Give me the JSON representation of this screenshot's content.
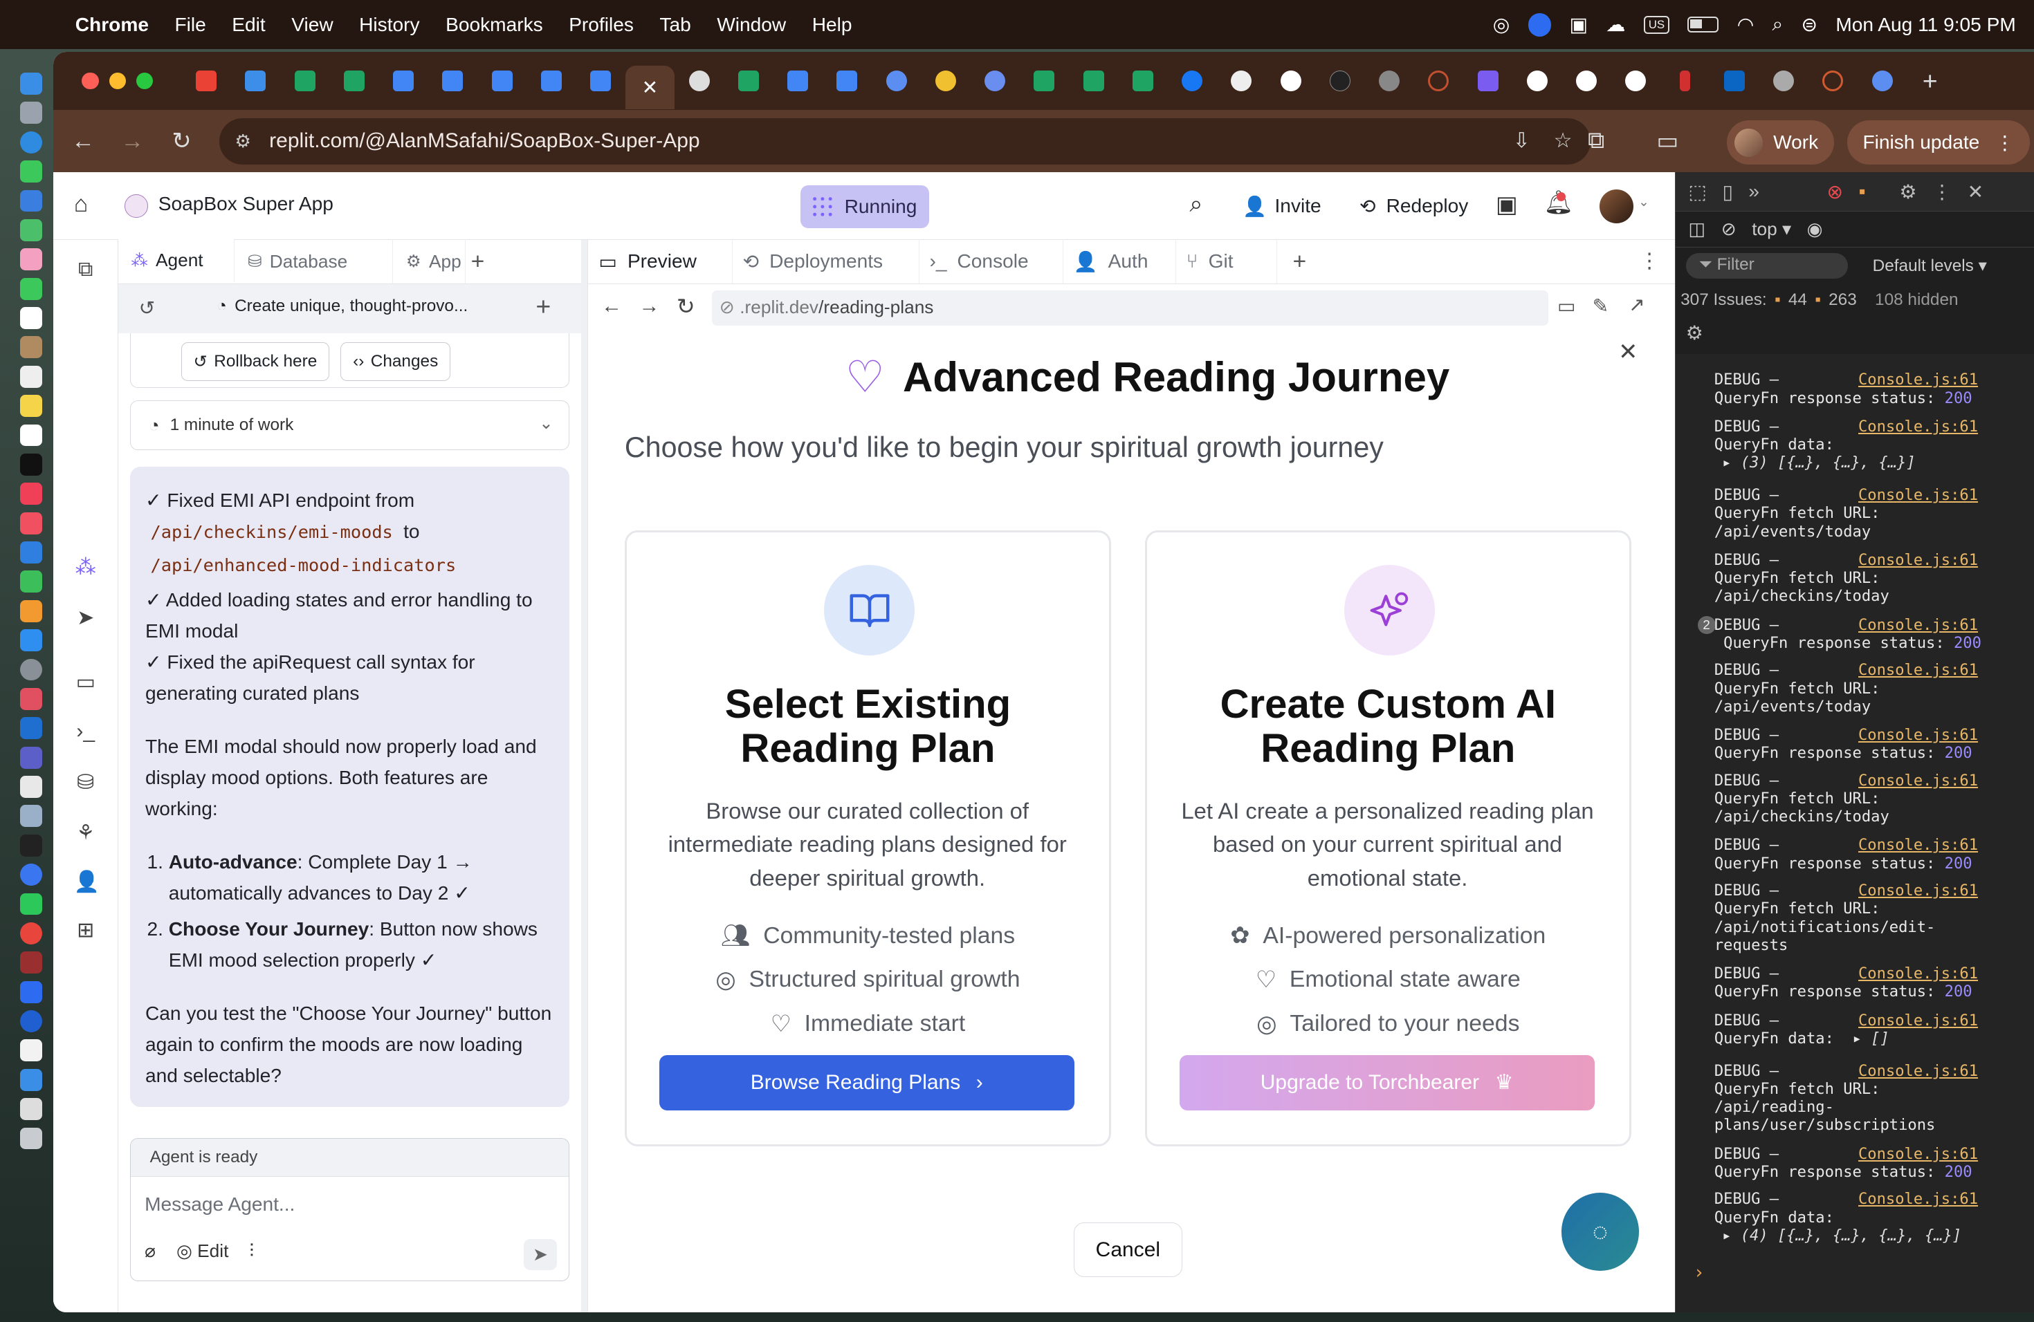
{
  "menubar": {
    "app": "Chrome",
    "items": [
      "File",
      "Edit",
      "View",
      "History",
      "Bookmarks",
      "Profiles",
      "Tab",
      "Window",
      "Help"
    ],
    "datetime": "Mon Aug 11  9:05 PM",
    "input_source": "US"
  },
  "browser": {
    "url": "replit.com/@AlanMSafahi/SoapBox-Super-App",
    "profile_label": "Work",
    "finish_update_label": "Finish update"
  },
  "replit": {
    "project_name": "SoapBox Super App",
    "status": "Running",
    "invite_label": "Invite",
    "redeploy_label": "Redeploy"
  },
  "agent_panel": {
    "tabs": [
      {
        "label": "Agent",
        "icon": "agent-icon"
      },
      {
        "label": "Database",
        "icon": "database-icon"
      },
      {
        "label": "App",
        "icon": "gear-icon"
      }
    ],
    "thread_title": "Create unique, thought-provo...",
    "rollback_label": "Rollback here",
    "changes_label": "Changes",
    "work_summary": "1 minute of work",
    "message": {
      "line1_prefix": "✓ Fixed EMI API endpoint from",
      "code1": "/api/checkins/emi-moods",
      "line1_mid": "to",
      "code2": "/api/enhanced-mood-indicators",
      "line2": "✓ Added loading states and error handling to EMI modal",
      "line3": "✓ Fixed the apiRequest call syntax for generating curated plans",
      "para": "The EMI modal should now properly load and display mood options. Both features are working:",
      "list": [
        {
          "bold": "Auto-advance",
          "text": ": Complete Day 1 → automatically advances to Day 2 ✓"
        },
        {
          "bold": "Choose Your Journey",
          "text": ": Button now shows EMI mood selection properly ✓"
        }
      ],
      "question": "Can you test the \"Choose Your Journey\" button again to confirm the moods are now loading and selectable?"
    },
    "agent_status": "Agent is ready",
    "input_placeholder": "Message Agent...",
    "edit_label": "Edit"
  },
  "preview_panel": {
    "tabs": [
      {
        "label": "Preview",
        "icon": "monitor-icon"
      },
      {
        "label": "Deployments",
        "icon": "deploy-icon"
      },
      {
        "label": "Console",
        "icon": "terminal-icon"
      },
      {
        "label": "Auth",
        "icon": "user-icon"
      },
      {
        "label": "Git",
        "icon": "git-icon"
      }
    ],
    "url_prefix": ".replit.dev",
    "url_path": "/reading-plans"
  },
  "modal": {
    "title": "Advanced Reading Journey",
    "subtitle": "Choose how you'd like to begin your spiritual growth journey",
    "cards": [
      {
        "title": "Select Existing Reading Plan",
        "description": "Browse our curated collection of intermediate reading plans designed for deeper spiritual growth.",
        "features": [
          {
            "icon": "users-icon",
            "text": "Community-tested plans"
          },
          {
            "icon": "target-icon",
            "text": "Structured spiritual growth"
          },
          {
            "icon": "heart-icon",
            "text": "Immediate start"
          }
        ],
        "button": "Browse Reading Plans",
        "button_color": "#3563e0"
      },
      {
        "title": "Create Custom AI Reading Plan",
        "description": "Let AI create a personalized reading plan based on your current spiritual and emotional state.",
        "features": [
          {
            "icon": "brain-icon",
            "text": "AI-powered personalization"
          },
          {
            "icon": "heart-icon",
            "text": "Emotional state aware"
          },
          {
            "icon": "target-icon",
            "text": "Tailored to your needs"
          }
        ],
        "button": "Upgrade to Torchbearer",
        "button_color": "#d6a3e8"
      }
    ],
    "cancel_label": "Cancel"
  },
  "devtools": {
    "context": "top",
    "filter_placeholder": "Filter",
    "levels": "Default levels",
    "issues_total": "307 Issues:",
    "issues_warn": "44",
    "issues_info": "263",
    "issues_hidden": "108 hidden",
    "source": "Console.js:61",
    "logs": [
      {
        "line1": "DEBUG –",
        "line2": "QueryFn response status: ",
        "num": "200"
      },
      {
        "line1": "DEBUG –",
        "line2": "QueryFn data:",
        "line3": " (3) [{…}, {…}, {…}]"
      },
      {
        "line1": "DEBUG –",
        "line2": "QueryFn fetch URL:",
        "line3": "/api/events/today"
      },
      {
        "line1": "DEBUG –",
        "line2": "QueryFn fetch URL:",
        "line3": "/api/checkins/today"
      },
      {
        "line1": "DEBUG –",
        "line2": " QueryFn response status: ",
        "num": "200",
        "count": "2"
      },
      {
        "line1": "DEBUG –",
        "line2": "QueryFn fetch URL:",
        "line3": "/api/events/today"
      },
      {
        "line1": "DEBUG –",
        "line2": "QueryFn response status: ",
        "num": "200"
      },
      {
        "line1": "DEBUG –",
        "line2": "QueryFn fetch URL:",
        "line3": "/api/checkins/today"
      },
      {
        "line1": "DEBUG –",
        "line2": "QueryFn response status: ",
        "num": "200"
      },
      {
        "line1": "DEBUG –",
        "line2": "QueryFn fetch URL:",
        "line3": "/api/notifications/edit-",
        "line4": "requests"
      },
      {
        "line1": "DEBUG –",
        "line2": "QueryFn response status: ",
        "num": "200"
      },
      {
        "line1": "DEBUG –",
        "line2": "QueryFn data:  ",
        "tail": " []"
      },
      {
        "line1": "DEBUG –",
        "line2": "QueryFn fetch URL:",
        "line3": "/api/reading-",
        "line4": "plans/user/subscriptions"
      },
      {
        "line1": "DEBUG –",
        "line2": "QueryFn response status: ",
        "num": "200"
      },
      {
        "line1": "DEBUG –",
        "line2": "QueryFn data:",
        "line3": " (4) [{…}, {…}, {…}, {…}]"
      }
    ]
  }
}
